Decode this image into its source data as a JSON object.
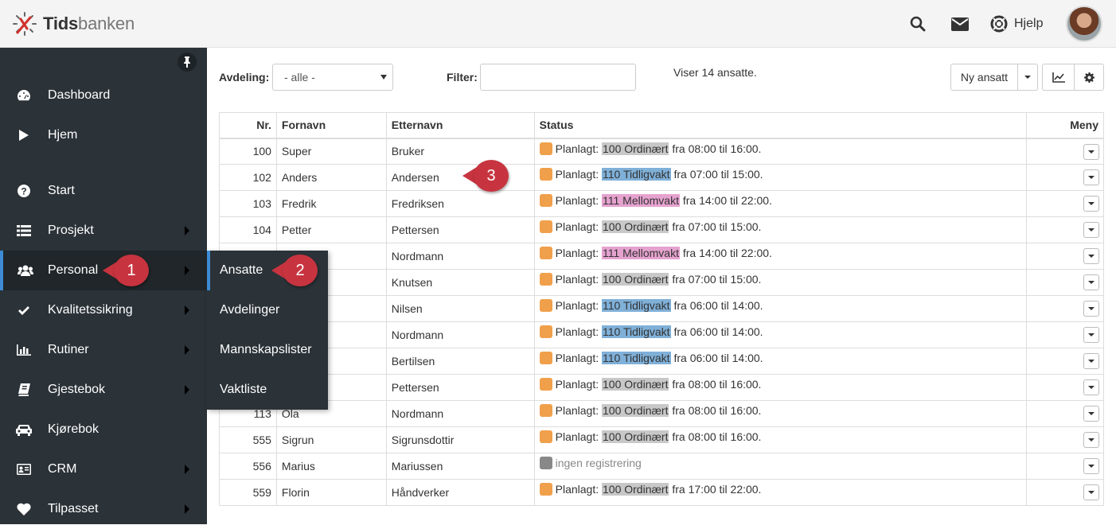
{
  "app": {
    "logo_part1": "Tids",
    "logo_part2": "banken"
  },
  "header": {
    "help_label": "Hjelp"
  },
  "sidebar": {
    "items": [
      {
        "label": "Dashboard",
        "icon": "dashboard-icon",
        "has_submenu": false
      },
      {
        "label": "Hjem",
        "icon": "play-icon",
        "has_submenu": false
      },
      {
        "label": "Start",
        "icon": "question-icon",
        "has_submenu": false
      },
      {
        "label": "Prosjekt",
        "icon": "list-icon",
        "has_submenu": true
      },
      {
        "label": "Personal",
        "icon": "users-icon",
        "has_submenu": true,
        "active": true
      },
      {
        "label": "Kvalitetssikring",
        "icon": "check-icon",
        "has_submenu": true
      },
      {
        "label": "Rutiner",
        "icon": "bar-chart-icon",
        "has_submenu": true
      },
      {
        "label": "Gjestebok",
        "icon": "book-icon",
        "has_submenu": true
      },
      {
        "label": "Kjørebok",
        "icon": "car-icon",
        "has_submenu": false
      },
      {
        "label": "CRM",
        "icon": "id-card-icon",
        "has_submenu": true
      },
      {
        "label": "Tilpasset",
        "icon": "heart-icon",
        "has_submenu": true
      }
    ]
  },
  "submenu": {
    "items": [
      "Ansatte",
      "Avdelinger",
      "Mannskapslister",
      "Vaktliste"
    ]
  },
  "callouts": [
    "1",
    "2",
    "3"
  ],
  "toolbar": {
    "department_label": "Avdeling:",
    "department_value": "- alle -",
    "filter_label": "Filter:",
    "filter_value": "",
    "count_text": "Viser 14 ansatte.",
    "new_employee_label": "Ny ansatt"
  },
  "table": {
    "columns": [
      "Nr.",
      "Fornavn",
      "Etternavn",
      "Status",
      "Meny"
    ],
    "rows": [
      {
        "nr": "100",
        "first": "Super",
        "last": "Bruker",
        "prefix": "Planlagt:",
        "shift": "100 Ordinært",
        "time": "fra 08:00 til 16:00.",
        "color": "gray"
      },
      {
        "nr": "102",
        "first": "Anders",
        "last": "Andersen",
        "prefix": "Planlagt:",
        "shift": "110 Tidligvakt",
        "time": "fra 07:00 til 15:00.",
        "color": "blue"
      },
      {
        "nr": "103",
        "first": "Fredrik",
        "last": "Fredriksen",
        "prefix": "Planlagt:",
        "shift": "111 Mellomvakt",
        "time": "fra 14:00 til 22:00.",
        "color": "pink"
      },
      {
        "nr": "104",
        "first": "Petter",
        "last": "Pettersen",
        "prefix": "Planlagt:",
        "shift": "100 Ordinært",
        "time": "fra 07:00 til 15:00.",
        "color": "gray"
      },
      {
        "nr": "",
        "first": "",
        "last": "Nordmann",
        "prefix": "Planlagt:",
        "shift": "111 Mellomvakt",
        "time": "fra 14:00 til 22:00.",
        "color": "pink"
      },
      {
        "nr": "",
        "first": "",
        "last": "Knutsen",
        "prefix": "Planlagt:",
        "shift": "100 Ordinært",
        "time": "fra 07:00 til 15:00.",
        "color": "gray"
      },
      {
        "nr": "",
        "first": "",
        "last": "Nilsen",
        "prefix": "Planlagt:",
        "shift": "110 Tidligvakt",
        "time": "fra 06:00 til 14:00.",
        "color": "blue"
      },
      {
        "nr": "",
        "first": "",
        "last": "Nordmann",
        "prefix": "Planlagt:",
        "shift": "110 Tidligvakt",
        "time": "fra 06:00 til 14:00.",
        "color": "blue"
      },
      {
        "nr": "",
        "first": "",
        "last": "Bertilsen",
        "prefix": "Planlagt:",
        "shift": "110 Tidligvakt",
        "time": "fra 06:00 til 14:00.",
        "color": "blue"
      },
      {
        "nr": "",
        "first": "",
        "last": "Pettersen",
        "prefix": "Planlagt:",
        "shift": "100 Ordinært",
        "time": "fra 08:00 til 16:00.",
        "color": "gray"
      },
      {
        "nr": "113",
        "first": "Ola",
        "last": "Nordmann",
        "prefix": "Planlagt:",
        "shift": "100 Ordinært",
        "time": "fra 08:00 til 16:00.",
        "color": "gray"
      },
      {
        "nr": "555",
        "first": "Sigrun",
        "last": "Sigrunsdottir",
        "prefix": "Planlagt:",
        "shift": "100 Ordinært",
        "time": "fra 08:00 til 16:00.",
        "color": "gray"
      },
      {
        "nr": "556",
        "first": "Marius",
        "last": "Mariussen",
        "prefix": "ingen registrering",
        "shift": "",
        "time": "",
        "color": "none"
      },
      {
        "nr": "559",
        "first": "Florin",
        "last": "Håndverker",
        "prefix": "Planlagt:",
        "shift": "100 Ordinært",
        "time": "fra 17:00 til 22:00.",
        "color": "gray"
      }
    ]
  },
  "colors": {
    "gray": "#c8c8c8",
    "blue": "#7fb0d8",
    "pink": "#e6a2cf",
    "orange_square": "#f0a04b",
    "gray_square": "#888888",
    "sidebar_bg": "#2b3238",
    "accent": "#3d8bd4",
    "callout": "#c7343f"
  }
}
